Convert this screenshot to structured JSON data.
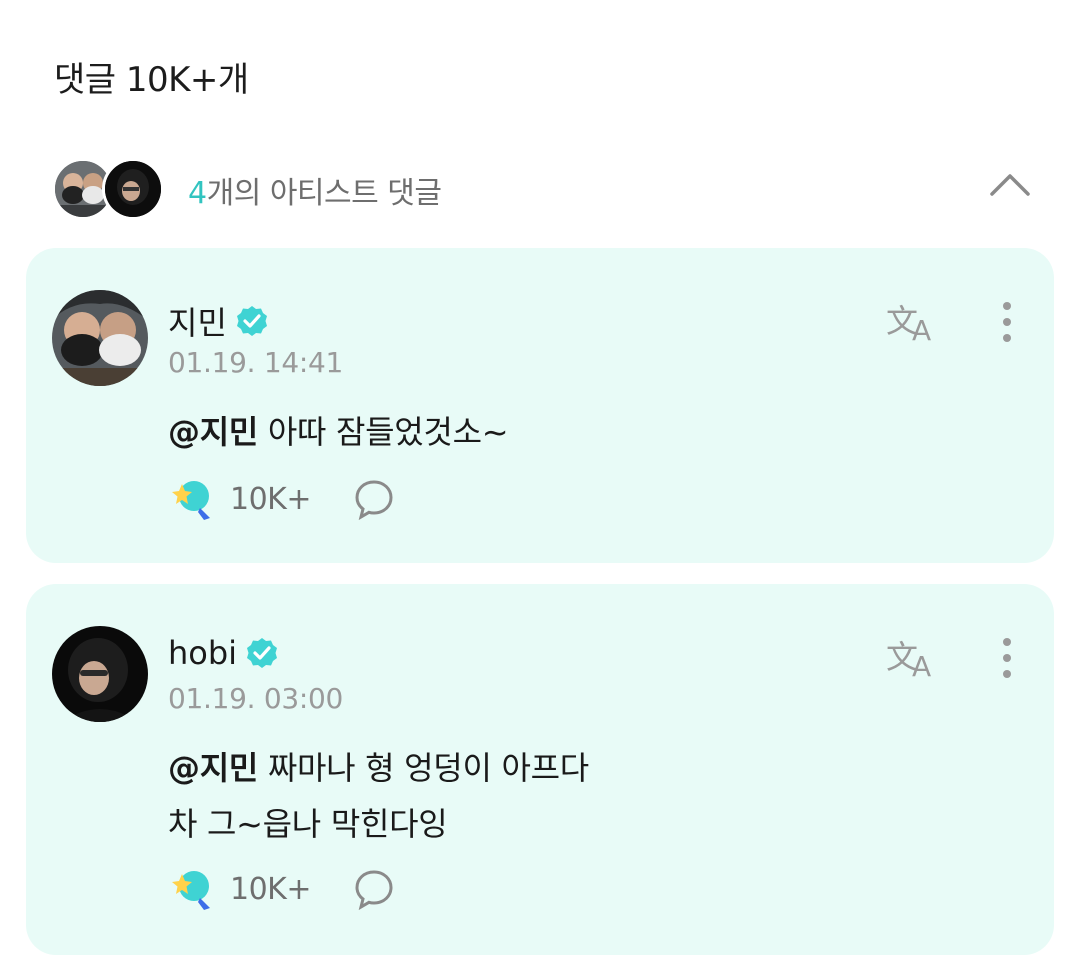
{
  "header": {
    "comment_count": "댓글 10K+개"
  },
  "artist_comments": {
    "count_prefix": "4",
    "label_suffix": "개의 아티스트 댓글",
    "toggle_icon": "chevron-up-icon"
  },
  "comments": [
    {
      "author": "지민",
      "verified": true,
      "timestamp": "01.19. 14:41",
      "mention": "@지민",
      "lines": [
        "아따 잠들었것소~"
      ],
      "cheer_count": "10K+",
      "icons": [
        "translate-icon",
        "more-icon",
        "cheer-icon",
        "reply-icon"
      ]
    },
    {
      "author": "hobi",
      "verified": true,
      "timestamp": "01.19. 03:00",
      "mention": "@지민",
      "lines": [
        "짜마나 형 엉덩이 아프다",
        "차 그~읍나 막힌다잉"
      ],
      "cheer_count": "10K+",
      "icons": [
        "translate-icon",
        "more-icon",
        "cheer-icon",
        "reply-icon"
      ]
    }
  ],
  "colors": {
    "accent": "#32c4c0",
    "card_background": "#e8fbf7",
    "verified": "#3fd3d3"
  }
}
